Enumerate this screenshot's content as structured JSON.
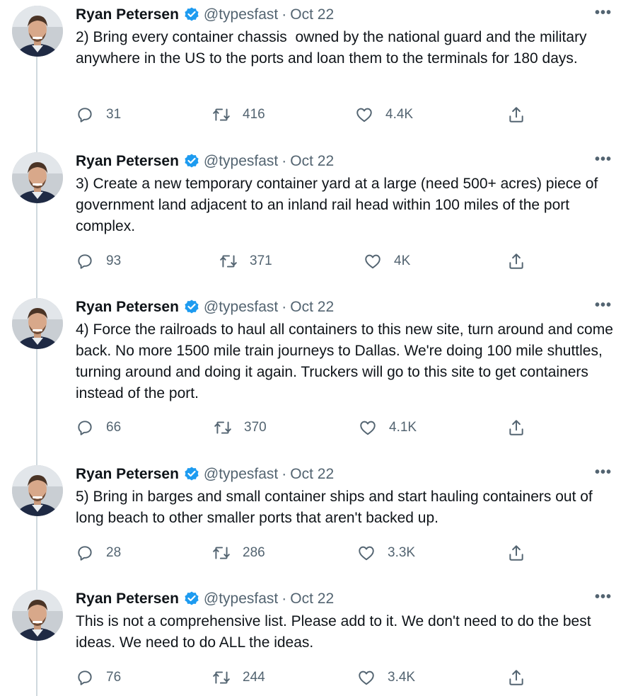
{
  "author": {
    "name": "Ryan Petersen",
    "handle": "@typesfast",
    "date": "Oct 22",
    "separator": "·"
  },
  "icons": {
    "verified": "verified-badge-icon",
    "more": "more-icon",
    "reply": "reply-icon",
    "retweet": "retweet-icon",
    "like": "heart-icon",
    "share": "share-icon"
  },
  "colors": {
    "verified": "#1d9bf0",
    "text": "#0f1419",
    "muted": "#536471",
    "thread_line": "#cfd9de"
  },
  "more_label": "•••",
  "tweets": [
    {
      "text": "2) Bring every container chassis  owned by the national guard and the military anywhere in the US to the ports and loan them to the terminals for 180 days.",
      "replies": "31",
      "retweets": "416",
      "likes": "4.4K"
    },
    {
      "text": "3) Create a new temporary container yard at a large (need 500+ acres) piece of government land adjacent to an inland rail head within 100 miles of the port complex.",
      "replies": "93",
      "retweets": "371",
      "likes": "4K"
    },
    {
      "text": "4) Force the railroads to haul all containers to this new site, turn around and come back. No more 1500 mile train journeys to Dallas. We're doing 100 mile shuttles, turning around and doing it again. Truckers will go to this site to get containers instead of the port.",
      "replies": "66",
      "retweets": "370",
      "likes": "4.1K"
    },
    {
      "text": "5) Bring in barges and small container ships and start hauling containers out of long beach to other smaller ports that aren't backed up.",
      "replies": "28",
      "retweets": "286",
      "likes": "3.3K"
    },
    {
      "text": "This is not a comprehensive list. Please add to it. We don't need to do the best ideas. We need to do ALL the ideas.",
      "replies": "76",
      "retweets": "244",
      "likes": "3.4K"
    }
  ]
}
